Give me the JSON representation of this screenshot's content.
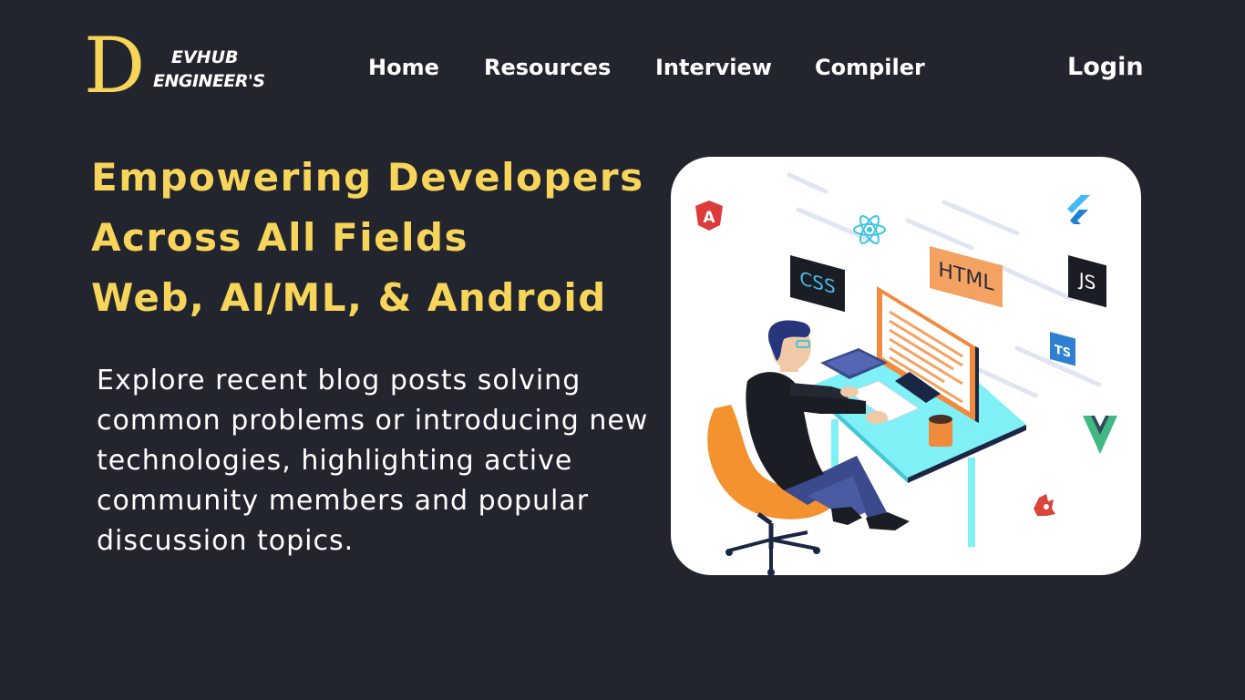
{
  "logo": {
    "letter": "D",
    "line1": "EVHUB",
    "line2": "ENGINEER'S"
  },
  "nav": {
    "home": "Home",
    "resources": "Resources",
    "interview": "Interview",
    "compiler": "Compiler",
    "login": "Login"
  },
  "hero": {
    "title_line1": "Empowering Developers",
    "title_line2": "Across All Fields",
    "title_line3": "Web, AI/ML, & Android",
    "description": "Explore recent blog posts solving common problems or introducing new technologies, highlighting active community members and popular discussion topics."
  },
  "illustration": {
    "css_label": "CSS",
    "html_label": "HTML",
    "js_label": "JS",
    "ts_label": "TS",
    "angular_letter": "A"
  },
  "colors": {
    "background": "#23252e",
    "accent_yellow": "#f7d55b",
    "text_white": "#ffffff"
  }
}
